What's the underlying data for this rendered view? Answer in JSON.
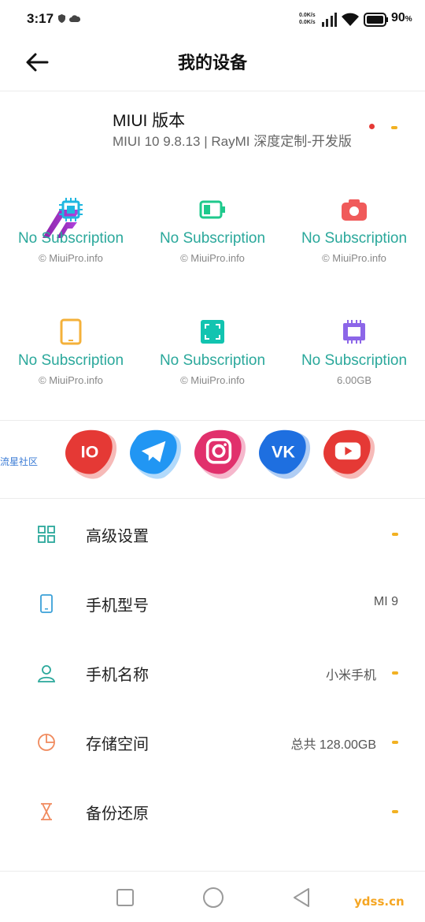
{
  "status_bar": {
    "time": "3:17",
    "net_up": "0.0K/s",
    "net_down": "0.0K/s",
    "battery": "90",
    "battery_unit": "%"
  },
  "header": {
    "title": "我的设备"
  },
  "miui": {
    "title": "MIUI 版本",
    "version": "MIUI 10 9.8.13 | RayMI 深度定制-开发版"
  },
  "grid": [
    {
      "icon": "cpu-icon",
      "caption": "No Subscription",
      "sub": "© MiuiPro.info",
      "color": "#1fb7e0"
    },
    {
      "icon": "battery-icon",
      "caption": "No Subscription",
      "sub": "© MiuiPro.info",
      "color": "#1ec98c"
    },
    {
      "icon": "camera-icon",
      "caption": "No Subscription",
      "sub": "© MiuiPro.info",
      "color": "#f05a5a"
    },
    {
      "icon": "tablet-icon",
      "caption": "No Subscription",
      "sub": "© MiuiPro.info",
      "color": "#f4b13a"
    },
    {
      "icon": "screen-icon",
      "caption": "No Subscription",
      "sub": "© MiuiPro.info",
      "color": "#12c4b0"
    },
    {
      "icon": "memory-icon",
      "caption": "No Subscription",
      "sub": "6.00GB",
      "color": "#8c66e8"
    }
  ],
  "social": {
    "side_text": "流星社区",
    "items": [
      {
        "name": "io-icon",
        "text": "IO",
        "color": "#e53935"
      },
      {
        "name": "telegram-icon",
        "color": "#2196f3"
      },
      {
        "name": "instagram-icon",
        "color": "#e1306c"
      },
      {
        "name": "vk-icon",
        "text": "VK",
        "color": "#1e6fe0"
      },
      {
        "name": "youtube-icon",
        "color": "#e53935"
      }
    ]
  },
  "list": [
    {
      "icon": "grid-settings-icon",
      "label": "高级设置",
      "value": "",
      "dash": true
    },
    {
      "icon": "phone-icon",
      "label": "手机型号",
      "value": "MI 9",
      "dash": false
    },
    {
      "icon": "person-icon",
      "label": "手机名称",
      "value": "小米手机",
      "dash": true
    },
    {
      "icon": "pie-storage-icon",
      "label": "存储空间",
      "value": "总共 128.00GB",
      "dash": true
    },
    {
      "icon": "hourglass-icon",
      "label": "备份还原",
      "value": "",
      "dash": true
    }
  ],
  "watermark": "ydss.cn",
  "colors": {
    "accent": "#2aa89b",
    "dash": "#f2b122"
  }
}
